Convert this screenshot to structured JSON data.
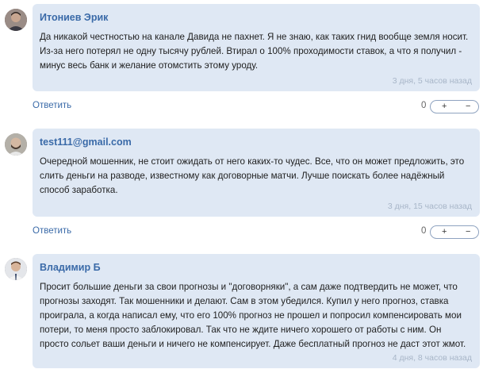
{
  "comments": [
    {
      "author": "Итониев Эрик",
      "text": "Да никакой честностью на канале Давида не пахнет. Я не знаю, как таких гнид вообще земля носит. Из-за него потерял не одну тысячу рублей. Втирал о 100% проходимости ставок, а что я получил - минус весь банк и желание отомстить этому уроду.",
      "time": "3 дня, 5 часов назад",
      "reply_label": "Ответить",
      "score": "0",
      "plus": "+",
      "minus": "−"
    },
    {
      "author": "test111@gmail.com",
      "text": "Очередной мошенник, не стоит ожидать от него каких-то чудес. Все, что он может предложить, это слить деньги на разводе, известному как договорные матчи. Лучше поискать более надёжный способ заработка.",
      "time": "3 дня, 15 часов назад",
      "reply_label": "Ответить",
      "score": "0",
      "plus": "+",
      "minus": "−"
    },
    {
      "author": "Владимир Б",
      "text": "Просит большие деньги за свои прогнозы и \"договорняки\", а сам даже подтвердить не может, что прогнозы заходят. Так мошенники и делают. Сам в этом убедился. Купил у него прогноз, ставка проиграла, а когда написал ему, что его 100% прогноз не прошел и попросил компенсировать мои потери, то меня просто заблокировал. Так что не ждите ничего хорошего от работы с ним. Он просто сольет ваши деньги и ничего не компенсирует. Даже бесплатный прогноз не даст этот жмот.",
      "time": "4 дня, 8 часов назад"
    }
  ]
}
